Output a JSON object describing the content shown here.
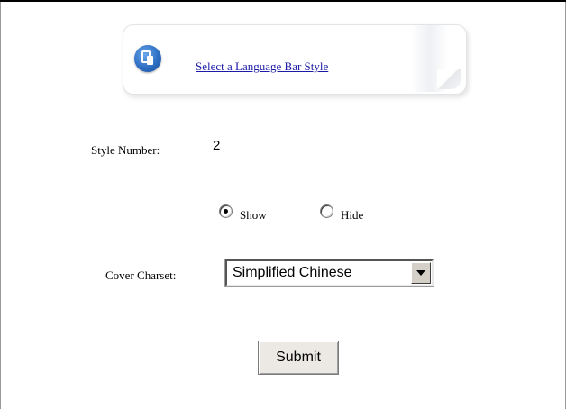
{
  "header": {
    "icon": "language-bar-icon",
    "link_text": "Select a Language Bar Style"
  },
  "style": {
    "label": "Style Number:",
    "value": "2"
  },
  "visibility": {
    "selected": "show",
    "options": [
      {
        "id": "show",
        "label": "Show"
      },
      {
        "id": "hide",
        "label": "Hide"
      }
    ]
  },
  "charset": {
    "label": "Cover Charset:",
    "selected_value": "Simplified Chinese"
  },
  "form": {
    "submit_label": "Submit"
  },
  "colors": {
    "link": "#1a1aa6",
    "icon_blue": "#2d6fc4"
  }
}
